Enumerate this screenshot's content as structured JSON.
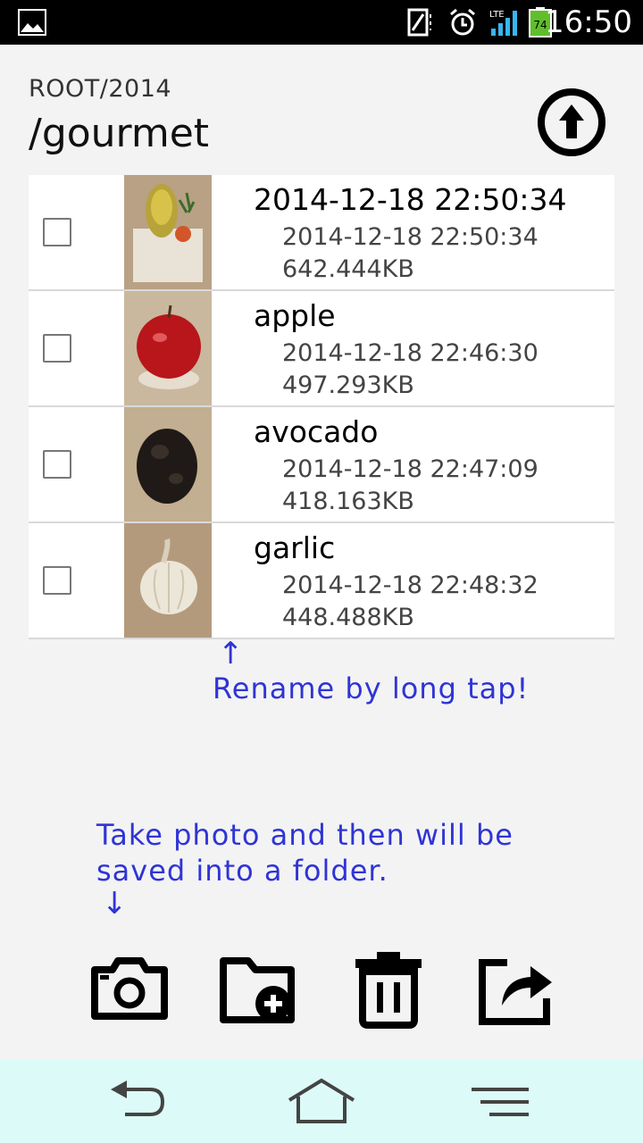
{
  "status_bar": {
    "time": "16:50",
    "battery_level": "74",
    "network_label": "LTE",
    "icons": [
      "gallery-icon",
      "vibrate-icon",
      "alarm-icon",
      "signal-icon",
      "battery-icon"
    ]
  },
  "header": {
    "breadcrumb": "ROOT/2014",
    "folder": "/gourmet",
    "up_icon": "arrow-up-circle-icon"
  },
  "files": [
    {
      "name": "2014-12-18 22:50:34",
      "date": "2014-12-18 22:50:34",
      "size": "642.444KB"
    },
    {
      "name": "apple",
      "date": "2014-12-18 22:46:30",
      "size": "497.293KB"
    },
    {
      "name": "avocado",
      "date": "2014-12-18 22:47:09",
      "size": "418.163KB"
    },
    {
      "name": "garlic",
      "date": "2014-12-18 22:48:32",
      "size": "448.488KB"
    }
  ],
  "hints": {
    "rename_arrow": "↑",
    "rename": "Rename by long tap!",
    "photo_line1": "Take photo and then will be",
    "photo_line2": "saved into a folder.",
    "photo_arrow": "↓"
  },
  "toolbar": [
    "camera-icon",
    "new-folder-icon",
    "trash-icon",
    "share-icon"
  ],
  "nav_bar": [
    "back-icon",
    "home-icon",
    "menu-icon"
  ],
  "colors": {
    "hint_text": "#2f34d6",
    "nav_bar_bg": "#dcfbf8",
    "background": "#f3f3f3"
  }
}
